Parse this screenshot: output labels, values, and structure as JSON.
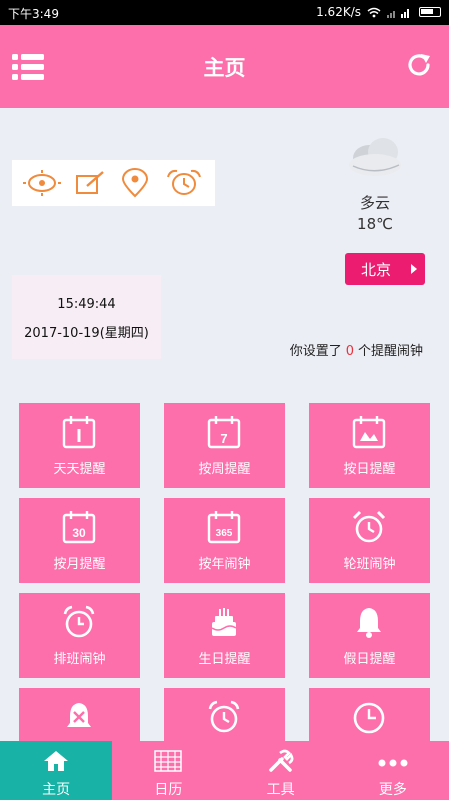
{
  "status_bar": {
    "time": "下午3:49",
    "speed": "1.62K/s"
  },
  "header": {
    "title": "主页"
  },
  "weather": {
    "condition": "多云",
    "temperature": "18℃",
    "city": "北京"
  },
  "clock": {
    "time": "15:49:44",
    "date": "2017-10-19(星期四)"
  },
  "alarm_info": {
    "prefix": "你设置了",
    "count": "0",
    "suffix": "个提醒闹钟"
  },
  "tiles": [
    {
      "label": "天天提醒",
      "icon": "calendar-1-icon"
    },
    {
      "label": "按周提醒",
      "icon": "calendar-7-icon"
    },
    {
      "label": "按日提醒",
      "icon": "calendar-day-icon"
    },
    {
      "label": "按月提醒",
      "icon": "calendar-30-icon"
    },
    {
      "label": "按年闹钟",
      "icon": "calendar-365-icon"
    },
    {
      "label": "轮班闹钟",
      "icon": "alarm-clock-icon"
    },
    {
      "label": "排班闹钟",
      "icon": "alarm-clock-outline-icon"
    },
    {
      "label": "生日提醒",
      "icon": "birthday-cake-icon"
    },
    {
      "label": "假日提醒",
      "icon": "bell-icon"
    },
    {
      "label": "",
      "icon": "bell-off-icon"
    },
    {
      "label": "",
      "icon": "alarm-clock-icon"
    },
    {
      "label": "",
      "icon": "clock-icon"
    }
  ],
  "tabbar": [
    {
      "label": "主页",
      "icon": "home-icon",
      "active": true
    },
    {
      "label": "日历",
      "icon": "calendar-grid-icon",
      "active": false
    },
    {
      "label": "工具",
      "icon": "tools-icon",
      "active": false
    },
    {
      "label": "更多",
      "icon": "more-dots-icon",
      "active": false
    }
  ],
  "colors": {
    "primary": "#fd6fab",
    "accent": "#ec1c70",
    "active_tab": "#18b3a6",
    "quick_icon": "#f08a3c"
  }
}
